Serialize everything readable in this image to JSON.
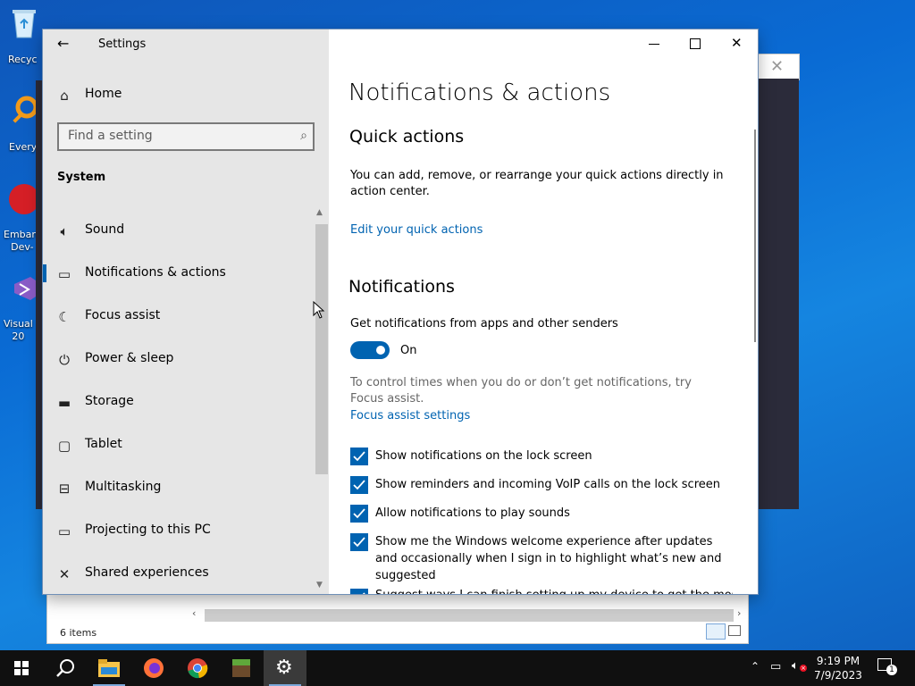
{
  "desktop": {
    "icons": [
      {
        "label": "Recyc",
        "name": "recycle-bin-icon"
      },
      {
        "label": "Every",
        "name": "everything-icon"
      },
      {
        "label": "Embarc\nDev-",
        "name": "embarcadero-icon"
      },
      {
        "label": "Visual\n20",
        "name": "visual-studio-icon"
      }
    ]
  },
  "background_window": {
    "status": "6 items"
  },
  "window": {
    "title": "Settings"
  },
  "nav": {
    "home": "Home",
    "search_placeholder": "Find a setting",
    "section": "System",
    "items": [
      {
        "label": "Sound",
        "icon": "speaker-icon"
      },
      {
        "label": "Notifications & actions",
        "icon": "notification-icon",
        "active": true
      },
      {
        "label": "Focus assist",
        "icon": "moon-icon"
      },
      {
        "label": "Power & sleep",
        "icon": "power-icon"
      },
      {
        "label": "Storage",
        "icon": "storage-icon"
      },
      {
        "label": "Tablet",
        "icon": "tablet-icon"
      },
      {
        "label": "Multitasking",
        "icon": "multitasking-icon"
      },
      {
        "label": "Projecting to this PC",
        "icon": "projector-icon"
      },
      {
        "label": "Shared experiences",
        "icon": "shared-icon"
      }
    ]
  },
  "content": {
    "title": "Notifications & actions",
    "quick_actions": {
      "heading": "Quick actions",
      "description": "You can add, remove, or rearrange your quick actions directly in action center.",
      "link": "Edit your quick actions"
    },
    "notifications": {
      "heading": "Notifications",
      "toggle_label": "Get notifications from apps and other senders",
      "toggle_state": "On",
      "toggle_on": true,
      "hint": "To control times when you do or don’t get notifications, try Focus assist.",
      "hint_link": "Focus assist settings",
      "checkboxes": [
        {
          "label": "Show notifications on the lock screen",
          "checked": true
        },
        {
          "label": "Show reminders and incoming VoIP calls on the lock screen",
          "checked": true
        },
        {
          "label": "Allow notifications to play sounds",
          "checked": true
        },
        {
          "label": "Show me the Windows welcome experience after updates and occasionally when I sign in to highlight what’s new and suggested",
          "checked": true
        },
        {
          "label": "Suggest ways I can finish setting up my device to get the most out of Windows",
          "checked": true
        }
      ]
    }
  },
  "taskbar": {
    "apps": [
      {
        "name": "start-icon"
      },
      {
        "name": "search-icon"
      },
      {
        "name": "file-explorer-icon"
      },
      {
        "name": "firefox-icon"
      },
      {
        "name": "chrome-icon"
      },
      {
        "name": "minecraft-icon"
      },
      {
        "name": "settings-icon"
      }
    ],
    "time": "9:19 PM",
    "date": "7/9/2023",
    "notification_count": "1"
  },
  "colors": {
    "accent": "#0063b1",
    "nav_bg": "#e6e6e6",
    "taskbar": "#101010"
  }
}
